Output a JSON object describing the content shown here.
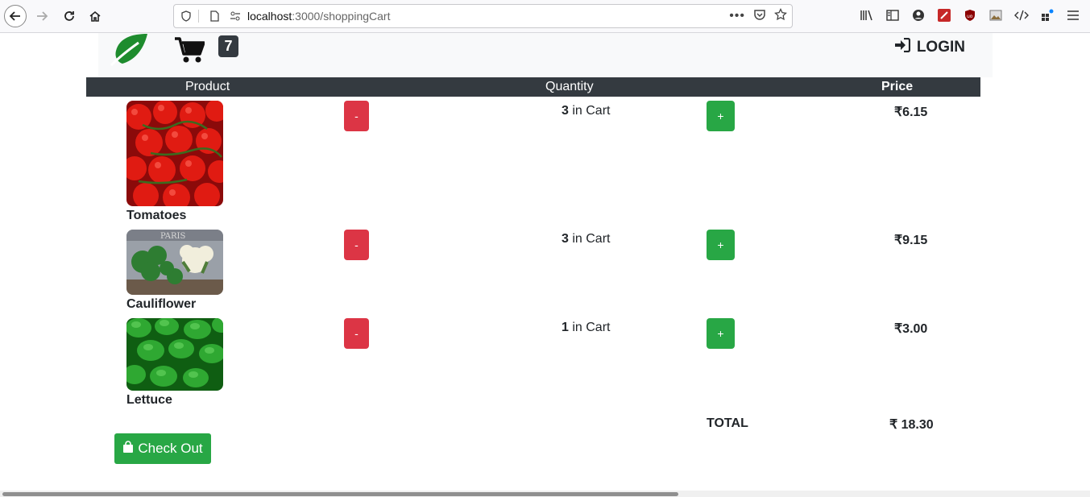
{
  "browser": {
    "url_host": "localhost",
    "url_path": ":3000/shoppingCart"
  },
  "header": {
    "cart_count": "7",
    "login_label": "LOGIN"
  },
  "table": {
    "columns": [
      "Product",
      "Quantity",
      "Price"
    ]
  },
  "items": [
    {
      "name": "Tomatoes",
      "qty": "3",
      "qty_suffix": " in Cart",
      "price": "₹6.15",
      "minus": "-",
      "plus": "+"
    },
    {
      "name": "Cauliflower",
      "qty": "3",
      "qty_suffix": " in Cart",
      "price": "₹9.15",
      "minus": "-",
      "plus": "+"
    },
    {
      "name": "Lettuce",
      "qty": "1",
      "qty_suffix": " in Cart",
      "price": "₹3.00",
      "minus": "-",
      "plus": "+"
    }
  ],
  "summary": {
    "total_label": "TOTAL",
    "total_value": "₹ 18.30"
  },
  "checkout_label": "Check Out",
  "colors": {
    "header_dark": "#343a40",
    "danger": "#dc3545",
    "success": "#28a745"
  }
}
